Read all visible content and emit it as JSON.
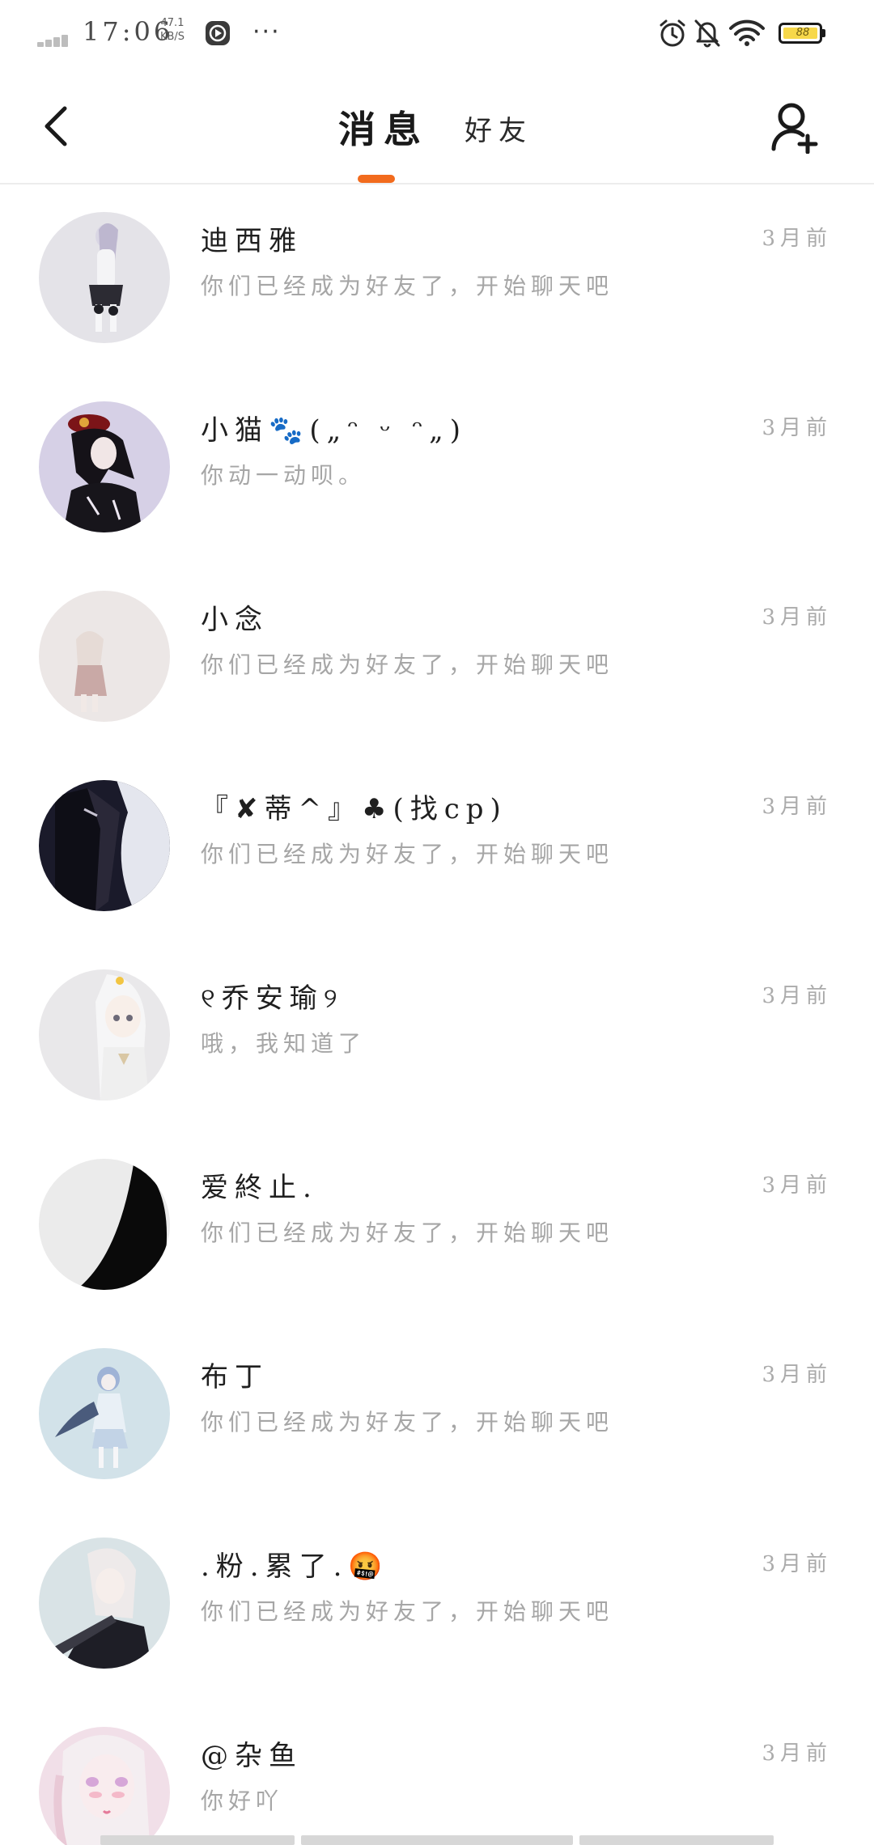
{
  "status_bar": {
    "time": "17:06",
    "net_speed_value": "47.1",
    "net_speed_unit": "KB/S",
    "more": "···",
    "battery_level": "88"
  },
  "header": {
    "tabs": [
      {
        "label": "消息",
        "active": true
      },
      {
        "label": "好友",
        "active": false
      }
    ],
    "accent_color": "#f26b1d"
  },
  "conversations": [
    {
      "name": "迪西雅",
      "preview": "你们已经成为好友了，开始聊天吧",
      "time": "3月前"
    },
    {
      "name": "小猫🐾(„ᵔ ᵕ ᵔ„)",
      "preview": "你动一动呗。",
      "time": "3月前"
    },
    {
      "name": "小念",
      "preview": "你们已经成为好友了，开始聊天吧",
      "time": "3月前"
    },
    {
      "name": "『✘蒂^』♣(找cp)",
      "preview": "你们已经成为好友了，开始聊天吧",
      "time": "3月前"
    },
    {
      "name": "୧乔安瑜୨",
      "preview": "哦，我知道了",
      "time": "3月前"
    },
    {
      "name": "爱終止.",
      "preview": "你们已经成为好友了，开始聊天吧",
      "time": "3月前"
    },
    {
      "name": "布丁",
      "preview": "你们已经成为好友了，开始聊天吧",
      "time": "3月前"
    },
    {
      "name": ".粉.累了.🤬",
      "preview": "你们已经成为好友了，开始聊天吧",
      "time": "3月前"
    },
    {
      "name": "@杂鱼",
      "preview": "你好吖",
      "time": "3月前"
    }
  ]
}
